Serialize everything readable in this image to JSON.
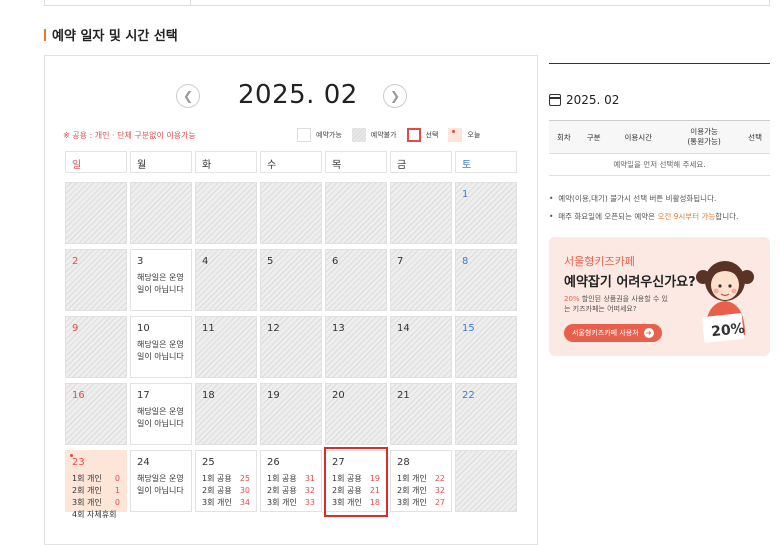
{
  "section": {
    "title": "예약 일자 및 시간 선택"
  },
  "calendar": {
    "month": "2025. 02",
    "prev_icon": "chevron-left-icon",
    "next_icon": "chevron-right-icon",
    "notice": "※ 공용 : 개인 · 단체 구분없이 이용가능",
    "legend": {
      "available": "예약가능",
      "unavailable": "예약불가",
      "selected": "선택",
      "today": "오늘"
    },
    "weekdays": [
      "일",
      "월",
      "화",
      "수",
      "목",
      "금",
      "토"
    ],
    "colors": {
      "sunday": "#e15050",
      "saturday": "#3d7bd6",
      "today_bg": "#fde6d8",
      "selected_border": "#d32f2f",
      "accent": "#e8792b"
    },
    "weeks": [
      [
        {
          "day": "",
          "state": "unavailable"
        },
        {
          "day": "",
          "state": "unavailable"
        },
        {
          "day": "",
          "state": "unavailable"
        },
        {
          "day": "",
          "state": "unavailable"
        },
        {
          "day": "",
          "state": "unavailable"
        },
        {
          "day": "",
          "state": "unavailable"
        },
        {
          "day": "1",
          "state": "unavailable",
          "weekday": "sat"
        }
      ],
      [
        {
          "day": "2",
          "state": "unavailable",
          "weekday": "sun"
        },
        {
          "day": "3",
          "state": "closed",
          "message": "해당일은 운영일이 아닙니다"
        },
        {
          "day": "4",
          "state": "unavailable"
        },
        {
          "day": "5",
          "state": "unavailable"
        },
        {
          "day": "6",
          "state": "unavailable"
        },
        {
          "day": "7",
          "state": "unavailable"
        },
        {
          "day": "8",
          "state": "unavailable",
          "weekday": "sat"
        }
      ],
      [
        {
          "day": "9",
          "state": "unavailable",
          "weekday": "sun"
        },
        {
          "day": "10",
          "state": "closed",
          "message": "해당일은 운영일이 아닙니다"
        },
        {
          "day": "11",
          "state": "unavailable"
        },
        {
          "day": "12",
          "state": "unavailable"
        },
        {
          "day": "13",
          "state": "unavailable"
        },
        {
          "day": "14",
          "state": "unavailable"
        },
        {
          "day": "15",
          "state": "unavailable",
          "weekday": "sat"
        }
      ],
      [
        {
          "day": "16",
          "state": "unavailable",
          "weekday": "sun"
        },
        {
          "day": "17",
          "state": "closed",
          "message": "해당일은 운영일이 아닙니다"
        },
        {
          "day": "18",
          "state": "unavailable"
        },
        {
          "day": "19",
          "state": "unavailable"
        },
        {
          "day": "20",
          "state": "unavailable"
        },
        {
          "day": "21",
          "state": "unavailable"
        },
        {
          "day": "22",
          "state": "unavailable",
          "weekday": "sat"
        }
      ],
      [
        {
          "day": "23",
          "state": "today",
          "weekday": "sun",
          "slots": [
            {
              "label": "1회 개인",
              "count": "0"
            },
            {
              "label": "2회 개인",
              "count": "1"
            },
            {
              "label": "3회 개인",
              "count": "0"
            },
            {
              "label": "4회 자체휴회",
              "count": ""
            }
          ]
        },
        {
          "day": "24",
          "state": "closed",
          "message": "해당일은 운영일이 아닙니다"
        },
        {
          "day": "25",
          "state": "available",
          "slots": [
            {
              "label": "1회 공용",
              "count": "25"
            },
            {
              "label": "2회 공용",
              "count": "30"
            },
            {
              "label": "3회 개인",
              "count": "34"
            }
          ]
        },
        {
          "day": "26",
          "state": "available",
          "slots": [
            {
              "label": "1회 공용",
              "count": "31"
            },
            {
              "label": "2회 공용",
              "count": "32"
            },
            {
              "label": "3회 개인",
              "count": "33"
            }
          ]
        },
        {
          "day": "27",
          "state": "available",
          "selected": true,
          "slots": [
            {
              "label": "1회 공용",
              "count": "19"
            },
            {
              "label": "2회 공용",
              "count": "21"
            },
            {
              "label": "3회 개인",
              "count": "18"
            }
          ]
        },
        {
          "day": "28",
          "state": "available",
          "slots": [
            {
              "label": "1회 개인",
              "count": "22"
            },
            {
              "label": "2회 개인",
              "count": "32"
            },
            {
              "label": "3회 개인",
              "count": "27"
            }
          ]
        },
        {
          "day": "",
          "state": "unavailable"
        }
      ]
    ]
  },
  "side": {
    "month_icon": "calendar-icon",
    "month": "2025. 02",
    "table": {
      "headers": [
        "회차",
        "구분",
        "이용시간",
        "이용가능\n(통원가능)",
        "선택"
      ],
      "empty_message": "예약일을 먼저 선택해 주세요."
    },
    "notes": [
      {
        "text": "예약(이용,대기) 불가시 선택 버튼 비활성화됩니다."
      },
      {
        "prefix": "매주 화요일에 오픈되는 예약은 ",
        "highlight": "오전 9시부터 가능",
        "suffix": "합니다."
      }
    ],
    "banner": {
      "small": "서울형키즈카페",
      "title": "예약잡기 어려우신가요?",
      "desc_highlight": "20%",
      "desc_rest": " 할인된 상품권을 사용할 수 있는 키즈카페는 어떠세요?",
      "button": "서울형키즈카페 사용처",
      "badge": "20%"
    }
  }
}
